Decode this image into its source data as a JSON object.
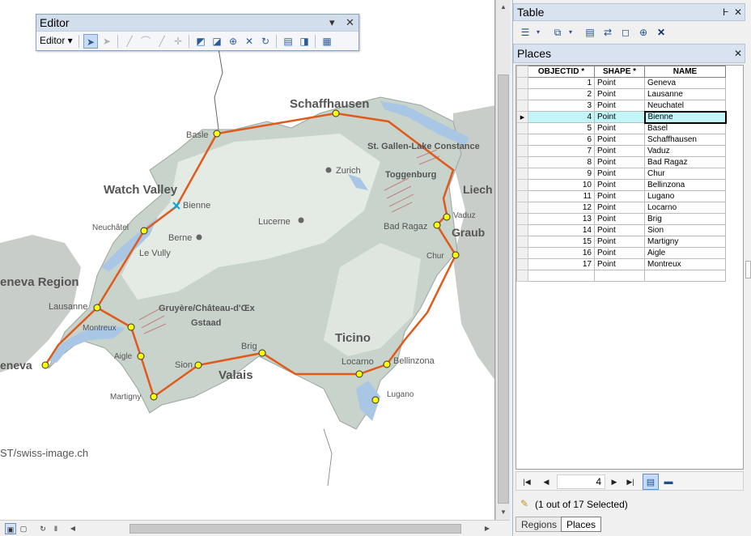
{
  "editor": {
    "title": "Editor",
    "menu_label": "Editor ▾",
    "dropdown_arrow": "▾",
    "close": "✕"
  },
  "map": {
    "labels": {
      "schaffhausen": "Schaffhausen",
      "basle": "Basle",
      "zurich": "Zurich",
      "stgallen": "St. Gallen-Lake Constance",
      "toggenburg": "Toggenburg",
      "watch_valley": "Watch Valley",
      "bienne": "Bienne",
      "liech": "Liech",
      "vaduz": "Vaduz",
      "bad_ragaz": "Bad Ragaz",
      "graub": "Graub",
      "neuchatel": "Neuchâtel",
      "berne": "Berne",
      "lucerne": "Lucerne",
      "le_vully": "Le Vully",
      "chur": "Chur",
      "geneva_region": "eneva Region",
      "lausanne": "Lausanne",
      "gruyere": "Gruyère/Château-d'Œx",
      "gstaad": "Gstaad",
      "montreux": "Montreux",
      "ticino": "Ticino",
      "aigle": "Aigle",
      "brig": "Brig",
      "geneva": "eneva",
      "sion": "Sion",
      "valais": "Valais",
      "locarno": "Locarno",
      "bellinzona": "Bellinzona",
      "martigny": "Martigny",
      "lugano": "Lugano",
      "credit": "ST/swiss-image.ch"
    }
  },
  "table": {
    "window_title": "Table",
    "pin": "Ⱶ",
    "close": "✕",
    "layer_title": "Places",
    "columns": [
      "OBJECTID *",
      "SHAPE *",
      "NAME"
    ],
    "rows": [
      {
        "oid": "1",
        "shape": "Point",
        "name": "Geneva"
      },
      {
        "oid": "2",
        "shape": "Point",
        "name": "Lausanne"
      },
      {
        "oid": "3",
        "shape": "Point",
        "name": "Neuchatel"
      },
      {
        "oid": "4",
        "shape": "Point",
        "name": "Bienne"
      },
      {
        "oid": "5",
        "shape": "Point",
        "name": "Basel"
      },
      {
        "oid": "6",
        "shape": "Point",
        "name": "Schaffhausen"
      },
      {
        "oid": "7",
        "shape": "Point",
        "name": "Vaduz"
      },
      {
        "oid": "8",
        "shape": "Point",
        "name": "Bad Ragaz"
      },
      {
        "oid": "9",
        "shape": "Point",
        "name": "Chur"
      },
      {
        "oid": "10",
        "shape": "Point",
        "name": "Bellinzona"
      },
      {
        "oid": "11",
        "shape": "Point",
        "name": "Lugano"
      },
      {
        "oid": "12",
        "shape": "Point",
        "name": "Locarno"
      },
      {
        "oid": "13",
        "shape": "Point",
        "name": "Brig"
      },
      {
        "oid": "14",
        "shape": "Point",
        "name": "Sion"
      },
      {
        "oid": "15",
        "shape": "Point",
        "name": "Martigny"
      },
      {
        "oid": "16",
        "shape": "Point",
        "name": "Aigle"
      },
      {
        "oid": "17",
        "shape": "Point",
        "name": "Montreux"
      }
    ],
    "selected_row_index": 3,
    "current_record": "4",
    "status": "(1 out of 17 Selected)",
    "tabs": [
      "Regions",
      "Places"
    ],
    "active_tab": "Places"
  },
  "colors": {
    "route": "#e05a1c",
    "vertex_fill": "#ffff00",
    "selection": "#c1f5f7",
    "panel_header": "#d9e3f0"
  }
}
